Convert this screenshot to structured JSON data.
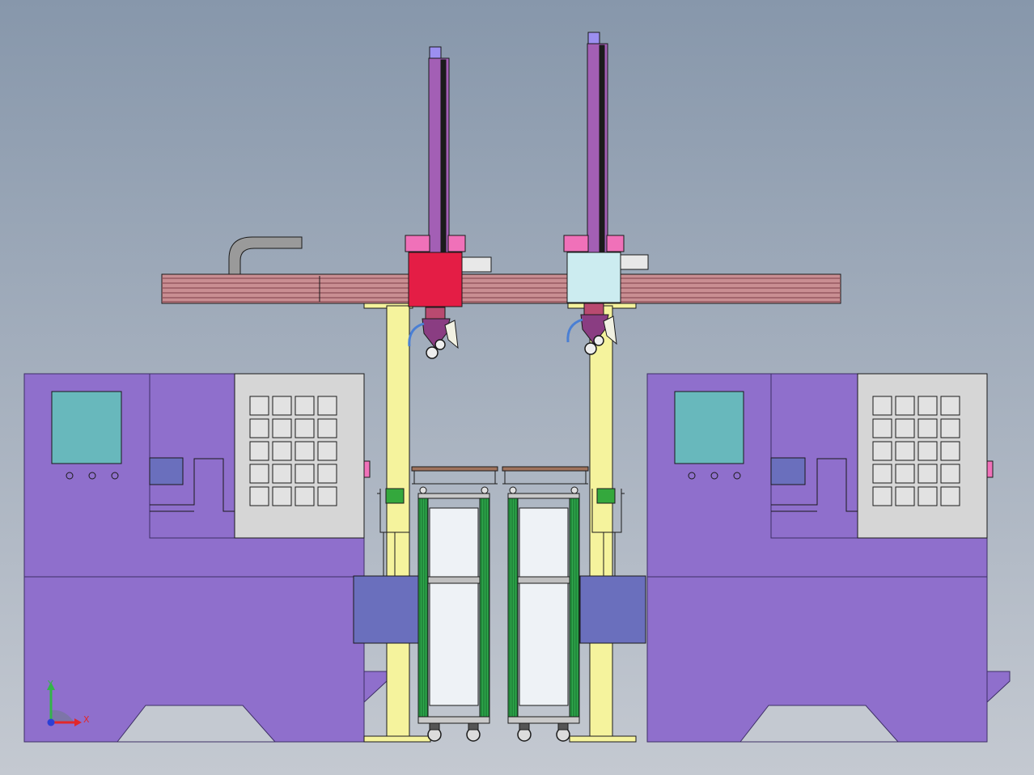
{
  "viewport": {
    "background_top": "#8797ab",
    "background_bottom": "#c4c9d1"
  },
  "colors": {
    "lathe_body": "#8f6fcc",
    "lathe_outline": "#3e2f66",
    "screen": "#68b8bc",
    "panel": "#d6d6d6",
    "panel_key": "#e2e2e2",
    "chuck": "#6a6fbd",
    "column": "#f5f39d",
    "rail": "#c98e92",
    "rail_dark": "#8d4e57",
    "carriage_red": "#e41d45",
    "carriage_light": "#ccecf0",
    "pink_block": "#f071b9",
    "vertical_arm": "#a35fb5",
    "cart_frame": "#2ea84c",
    "cart_panel": "#eef2f6",
    "tray": "#a0735c",
    "roller": "#34a83d",
    "cable_duct": "#9a9a9a"
  },
  "triad": {
    "x_label": "X",
    "y_label": "Y",
    "x_color": "#e2272a",
    "y_color": "#34b34a",
    "origin_color": "#2b3fd6"
  }
}
